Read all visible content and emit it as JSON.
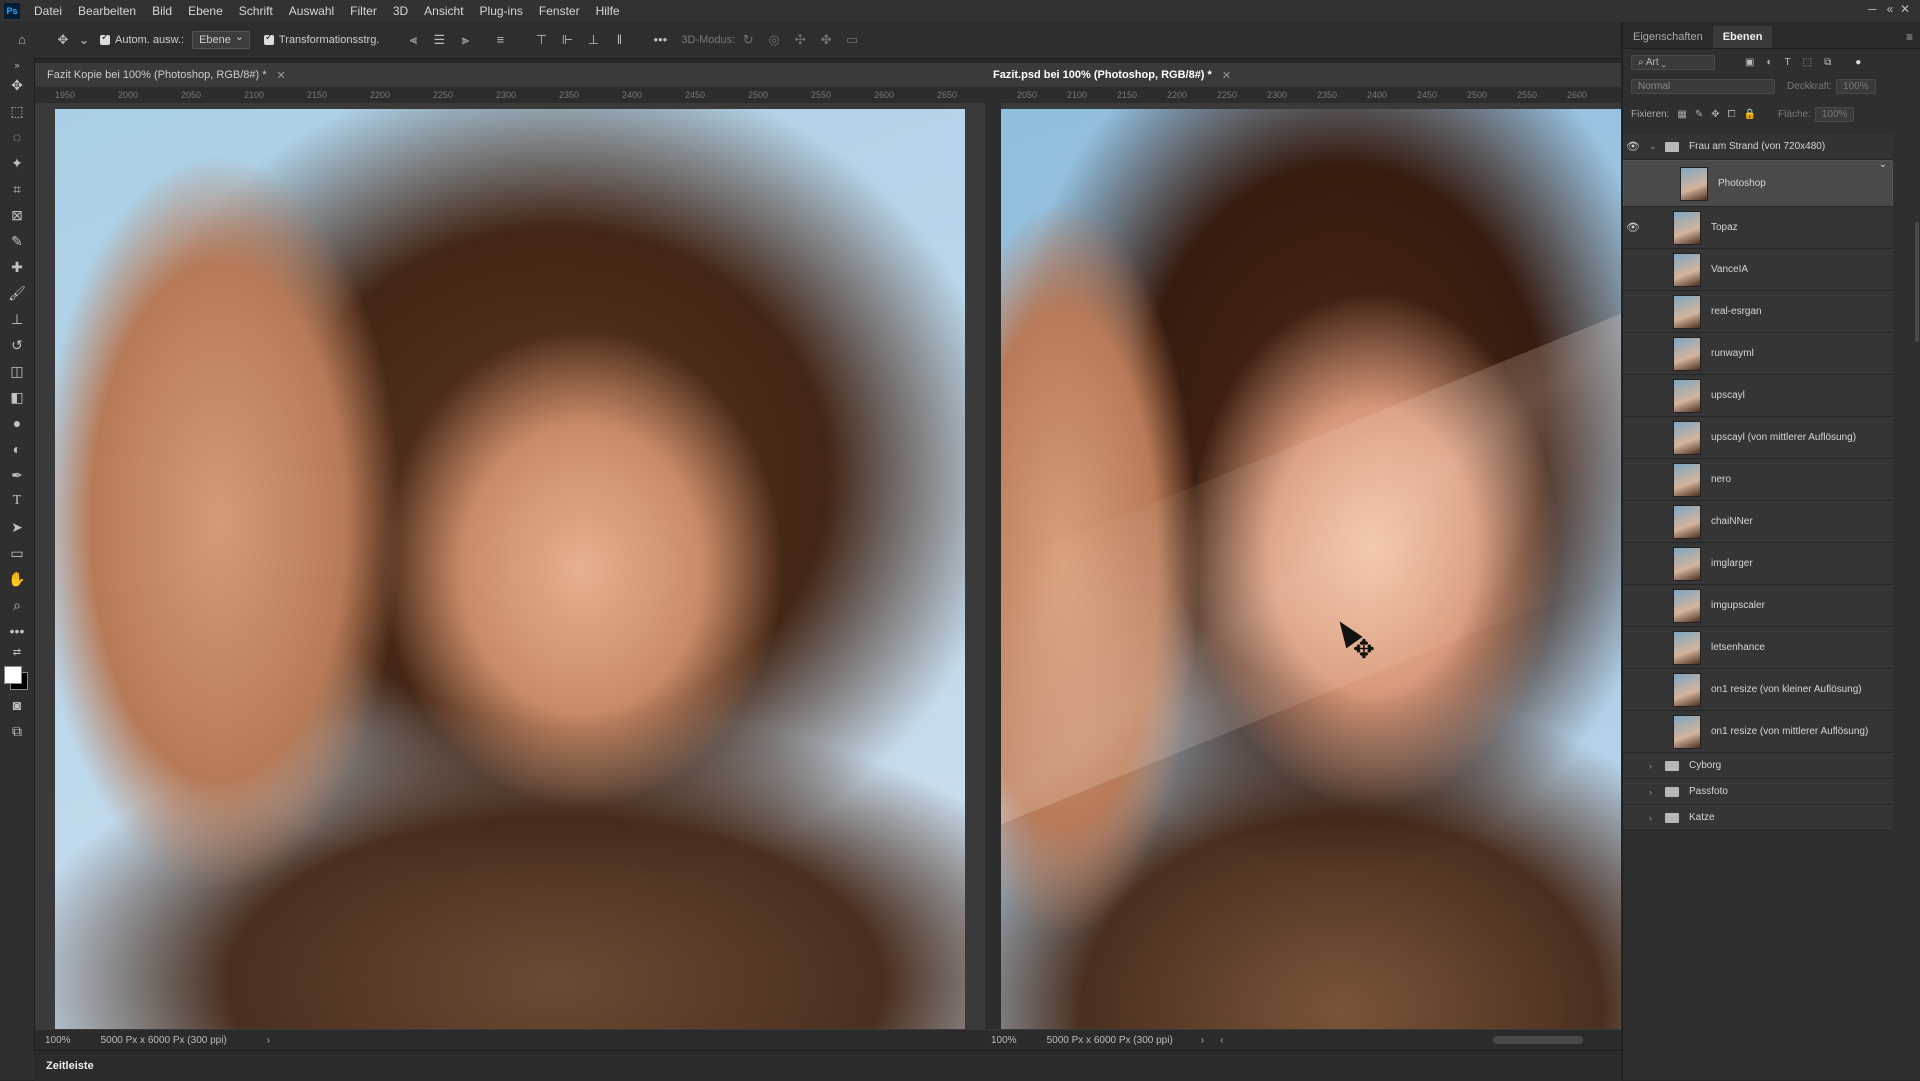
{
  "app": {
    "logo": "Ps"
  },
  "menu": [
    "Datei",
    "Bearbeiten",
    "Bild",
    "Ebene",
    "Schrift",
    "Auswahl",
    "Filter",
    "3D",
    "Ansicht",
    "Plug-ins",
    "Fenster",
    "Hilfe"
  ],
  "options": {
    "auto_select_label": "Autom. ausw.:",
    "auto_select_target": "Ebene",
    "transform_label": "Transformationsstrg.",
    "mode_3d_label": "3D-Modus:"
  },
  "documents": [
    {
      "tab_title": "Fazit Kopie bei 100% (Photoshop, RGB/8#) *",
      "ruler_ticks": [
        "1950",
        "2000",
        "2050",
        "2100",
        "2150",
        "2200",
        "2250",
        "2300",
        "2350",
        "2400",
        "2450",
        "2500",
        "2550",
        "2600",
        "2650"
      ],
      "zoom": "100%",
      "doc_info": "5000 Px x 6000 Px (300 ppi)"
    },
    {
      "tab_title": "Fazit.psd bei 100% (Photoshop, RGB/8#) *",
      "ruler_ticks": [
        "2050",
        "2100",
        "2150",
        "2200",
        "2250",
        "2300",
        "2350",
        "2400",
        "2450",
        "2500",
        "2550",
        "2600"
      ],
      "zoom": "100%",
      "doc_info": "5000 Px x 6000 Px (300 ppi)"
    }
  ],
  "panel": {
    "tabs": [
      "Eigenschaften",
      "Ebenen"
    ],
    "active_tab": "Ebenen",
    "filter_label": "Art",
    "blend_mode": "Normal",
    "opacity_label": "Deckkraft:",
    "opacity_value": "100%",
    "lock_label": "Fixieren:",
    "fill_label": "Fläche:",
    "fill_value": "100%",
    "group_open": "Frau am Strand (von 720x480)",
    "layers": [
      {
        "name": "Photoshop",
        "visible": false,
        "selected": true
      },
      {
        "name": "Topaz",
        "visible": true,
        "selected": false
      },
      {
        "name": "VanceIA",
        "visible": false,
        "selected": false
      },
      {
        "name": "real-esrgan",
        "visible": false,
        "selected": false
      },
      {
        "name": "runwayml",
        "visible": false,
        "selected": false
      },
      {
        "name": "upscayl",
        "visible": false,
        "selected": false
      },
      {
        "name": "upscayl (von mittlerer Auflösung)",
        "visible": false,
        "selected": false
      },
      {
        "name": "nero",
        "visible": false,
        "selected": false
      },
      {
        "name": "chaiNNer",
        "visible": false,
        "selected": false
      },
      {
        "name": "imglarger",
        "visible": false,
        "selected": false
      },
      {
        "name": "imgupscaler",
        "visible": false,
        "selected": false
      },
      {
        "name": "letsenhance",
        "visible": false,
        "selected": false
      },
      {
        "name": "on1 resize (von kleiner Auflösung)",
        "visible": false,
        "selected": false
      },
      {
        "name": "on1 resize (von mittlerer Auflösung)",
        "visible": false,
        "selected": false
      }
    ],
    "groups_closed": [
      "Cyborg",
      "Passfoto",
      "Katze"
    ]
  },
  "bottom": {
    "timeline_label": "Zeitleiste"
  },
  "colors": {
    "accent": "#31a8ff",
    "panel_bg": "#2f2f2f",
    "canvas_bg": "#3a3a3a"
  }
}
